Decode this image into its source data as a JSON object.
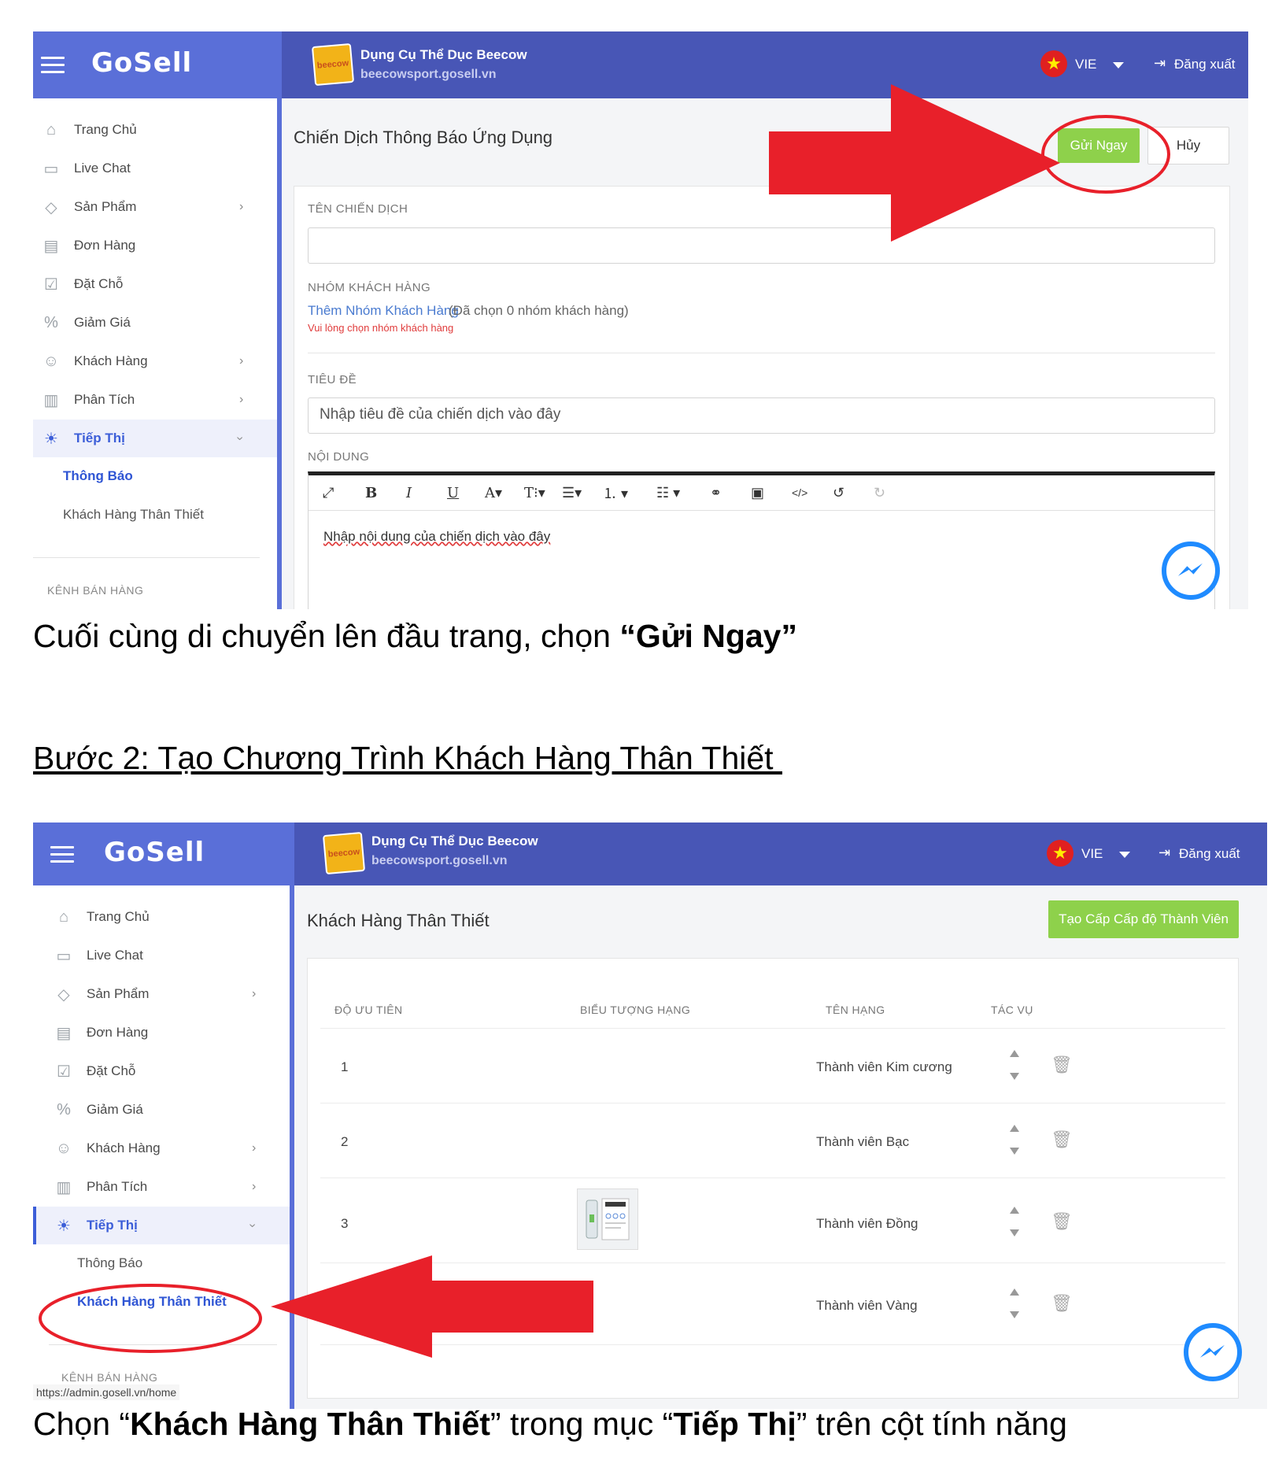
{
  "app": {
    "logo_text": "GoSell",
    "store_name": "Dụng Cụ Thể Dục Beecow",
    "store_url": "beecowsport.gosell.vn",
    "store_logo_text": "beecow",
    "language": "VIE",
    "logout_label": "Đăng xuất"
  },
  "sidebar": {
    "items": [
      {
        "label": "Trang Chủ",
        "icon": "home-icon"
      },
      {
        "label": "Live Chat",
        "icon": "chat-icon"
      },
      {
        "label": "Sản Phẩm",
        "icon": "tag-icon",
        "has_children": true
      },
      {
        "label": "Đơn Hàng",
        "icon": "receipt-icon"
      },
      {
        "label": "Đặt Chỗ",
        "icon": "calendar-check-icon"
      },
      {
        "label": "Giảm Giá",
        "icon": "percent-icon"
      },
      {
        "label": "Khách Hàng",
        "icon": "users-icon",
        "has_children": true
      },
      {
        "label": "Phân Tích",
        "icon": "chart-icon",
        "has_children": true
      },
      {
        "label": "Tiếp Thị",
        "icon": "lightbulb-icon",
        "expanded": true
      }
    ],
    "sub_items": [
      "Thông Báo",
      "Khách Hàng Thân Thiết"
    ],
    "section_label": "KÊNH BÁN HÀNG"
  },
  "screen1": {
    "page_title": "Chiến Dịch Thông Báo Ứng Dụng",
    "send_button": "Gửi Ngay",
    "cancel_button": "Hủy",
    "campaign_name_label": "TÊN CHIẾN DỊCH",
    "campaign_name_value": "",
    "customer_group_label": "NHÓM KHÁCH HÀNG",
    "add_group_link": "Thêm Nhóm Khách Hàng",
    "selected_groups_text": "(Đã chọn 0 nhóm khách hàng)",
    "group_error": "Vui lòng chọn nhóm khách hàng",
    "title_label": "TIÊU ĐỀ",
    "title_placeholder": "Nhập tiêu đề của chiến dịch vào đây",
    "content_label": "NỘI DUNG",
    "content_placeholder": "Nhập nội dung của chiến dịch vào đây",
    "active_sub_item": "Thông Báo"
  },
  "caption1": {
    "text": "Cuối cùng di chuyển lên đầu trang, chọn ",
    "bold": "“Gửi Ngay”"
  },
  "heading2": "Bước 2: Tạo Chương Trình Khách Hàng Thân Thiết ",
  "screen2": {
    "page_title": "Khách Hàng Thân Thiết",
    "create_button": "Tạo Cấp Cấp độ Thành Viên",
    "columns": [
      "ĐỘ ƯU TIÊN",
      "BIỂU TƯỢNG HẠNG",
      "TÊN HẠNG",
      "TÁC VỤ"
    ],
    "rows": [
      {
        "priority": "1",
        "name": "Thành viên Kim cương",
        "has_image": false
      },
      {
        "priority": "2",
        "name": "Thành viên Bạc",
        "has_image": false
      },
      {
        "priority": "3",
        "name": "Thành viên Đồng",
        "has_image": true
      },
      {
        "priority": "",
        "name": "Thành viên Vàng",
        "has_image": false
      }
    ],
    "status_url": "https://admin.gosell.vn/home",
    "active_sub_item": "Khách Hàng Thân Thiết"
  },
  "caption2": {
    "pre": "Chọn “",
    "bold1": "Khách Hàng Thân Thiết",
    "mid": "”  trong mục “",
    "bold2": "Tiếp Thị",
    "post": "” trên cột tính năng"
  },
  "colors": {
    "topbar": "#4856b6",
    "logo_bg": "#5a6fd8",
    "green_button": "#8ed14b",
    "annotation_red": "#e8202a",
    "active_blue": "#2f55d4"
  }
}
